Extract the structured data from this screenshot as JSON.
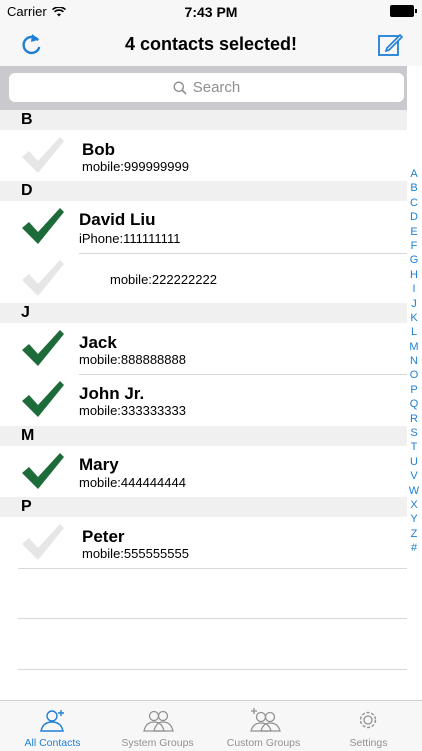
{
  "status_bar": {
    "carrier": "Carrier",
    "time": "7:43 PM"
  },
  "nav": {
    "title": "4 contacts selected!"
  },
  "search": {
    "placeholder": "Search"
  },
  "sections": {
    "b": "B",
    "d": "D",
    "j": "J",
    "m": "M",
    "p": "P"
  },
  "contacts": {
    "bob": {
      "name": "Bob",
      "number": "mobile:999999999",
      "selected": false
    },
    "david": {
      "name": "David Liu",
      "number": "iPhone:111111111",
      "selected": true
    },
    "david2": {
      "number": "mobile:222222222",
      "selected": false
    },
    "jack": {
      "name": "Jack",
      "number": "mobile:888888888",
      "selected": true
    },
    "john": {
      "name": "John Jr.",
      "number": "mobile:333333333",
      "selected": true
    },
    "mary": {
      "name": "Mary",
      "number": "mobile:444444444",
      "selected": true
    },
    "peter": {
      "name": "Peter",
      "number": "mobile:555555555",
      "selected": false
    }
  },
  "index_letters": [
    "A",
    "B",
    "C",
    "D",
    "E",
    "F",
    "G",
    "H",
    "I",
    "J",
    "K",
    "L",
    "M",
    "N",
    "O",
    "P",
    "Q",
    "R",
    "S",
    "T",
    "U",
    "V",
    "W",
    "X",
    "Y",
    "Z",
    "#"
  ],
  "tabs": {
    "all": "All Contacts",
    "system": "System Groups",
    "custom": "Custom Groups",
    "settings": "Settings"
  },
  "colors": {
    "accent": "#1f7ed6",
    "check_selected": "#1e6b3a",
    "check_unselected": "#e6e6e6"
  }
}
